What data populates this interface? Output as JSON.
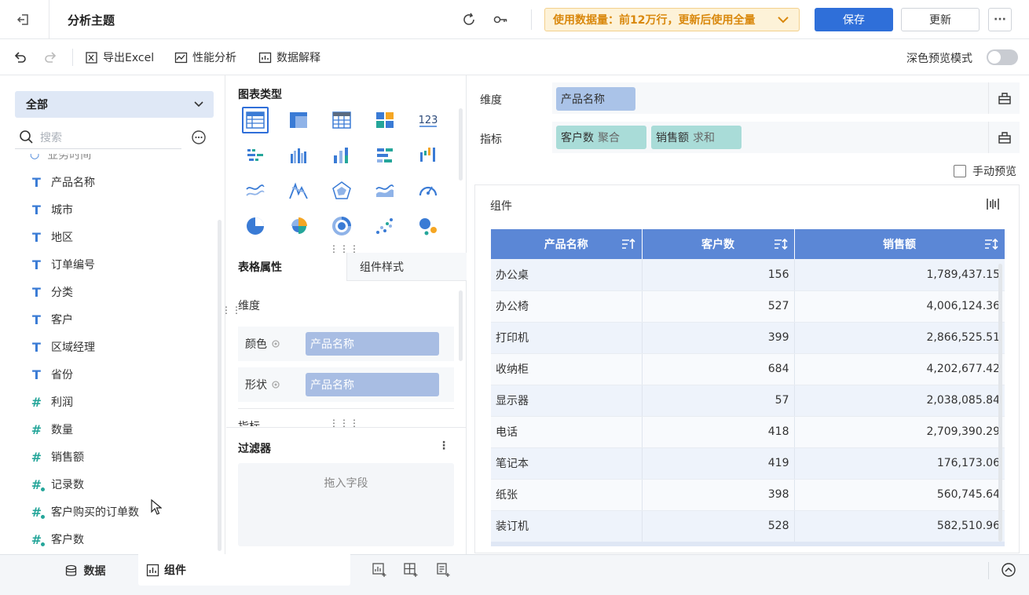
{
  "header": {
    "title": "分析主题",
    "banner": "使用数据量：前12万行，更新后使用全量",
    "save_label": "保存",
    "update_label": "更新",
    "more_label": "···"
  },
  "toolbar": {
    "export_label": "导出Excel",
    "perf_label": "性能分析",
    "explain_label": "数据解释",
    "dark_preview_label": "深色预览模式",
    "dark_preview_on": false
  },
  "fields_panel": {
    "selector_label": "全部",
    "search_placeholder": "搜索",
    "items": [
      {
        "label": "产品名称",
        "kind": "text"
      },
      {
        "label": "城市",
        "kind": "text"
      },
      {
        "label": "地区",
        "kind": "text"
      },
      {
        "label": "订单编号",
        "kind": "text"
      },
      {
        "label": "分类",
        "kind": "text"
      },
      {
        "label": "客户",
        "kind": "text"
      },
      {
        "label": "区域经理",
        "kind": "text"
      },
      {
        "label": "省份",
        "kind": "text"
      },
      {
        "label": "利润",
        "kind": "number"
      },
      {
        "label": "数量",
        "kind": "number"
      },
      {
        "label": "销售额",
        "kind": "number"
      },
      {
        "label": "记录数",
        "kind": "calc-number"
      },
      {
        "label": "客户购买的订单数",
        "kind": "calc-number"
      },
      {
        "label": "客户数",
        "kind": "calc-number"
      }
    ]
  },
  "chart_types": {
    "title": "图表类型",
    "icons": [
      "table-icon",
      "cross-table-icon",
      "detail-table-icon",
      "kpi-card-icon",
      "number-icon",
      "grouped-bar-icon",
      "column-icon",
      "stacked-column-icon",
      "bar-icon",
      "waterfall-icon",
      "line-icon",
      "star-line-icon",
      "radar-icon",
      "area-icon",
      "gauge-icon",
      "pie-icon",
      "rose-icon",
      "ring-icon",
      "scatter-icon",
      "bubble-icon"
    ]
  },
  "properties": {
    "tab_table": "表格属性",
    "tab_style": "组件样式",
    "dimension_label": "维度",
    "color_label": "颜色",
    "shape_label": "形状",
    "color_field": "产品名称",
    "shape_field": "产品名称",
    "measure_label_partial": "指标"
  },
  "filter": {
    "title": "过滤器",
    "drop_hint": "拖入字段"
  },
  "shelves": {
    "dimension_label": "维度",
    "measure_label": "指标",
    "dimension_fields": [
      "产品名称"
    ],
    "measure_fields": [
      {
        "name": "客户数",
        "agg": "聚合"
      },
      {
        "name": "销售额",
        "agg": "求和"
      }
    ],
    "manual_preview_label": "手动预览"
  },
  "component": {
    "title": "组件",
    "table": {
      "headers": [
        "产品名称",
        "客户数",
        "销售额"
      ],
      "rows": [
        [
          "办公桌",
          "156",
          "1,789,437.15"
        ],
        [
          "办公椅",
          "527",
          "4,006,124.36"
        ],
        [
          "打印机",
          "399",
          "2,866,525.51"
        ],
        [
          "收纳柜",
          "684",
          "4,202,677.42"
        ],
        [
          "显示器",
          "57",
          "2,038,085.84"
        ],
        [
          "电话",
          "418",
          "2,709,390.29"
        ],
        [
          "笔记本",
          "419",
          "176,173.06"
        ],
        [
          "纸张",
          "398",
          "560,745.64"
        ],
        [
          "装订机",
          "528",
          "582,510.96"
        ]
      ]
    }
  },
  "bottom": {
    "data_tab": "数据",
    "component_tab": "组件"
  },
  "colors": {
    "primary": "#2f6fd9",
    "table_header": "#5b87d6",
    "banner_text": "#d9880d",
    "measure_pill": "#a9dcd8",
    "dimension_pill": "#aac3e8"
  }
}
